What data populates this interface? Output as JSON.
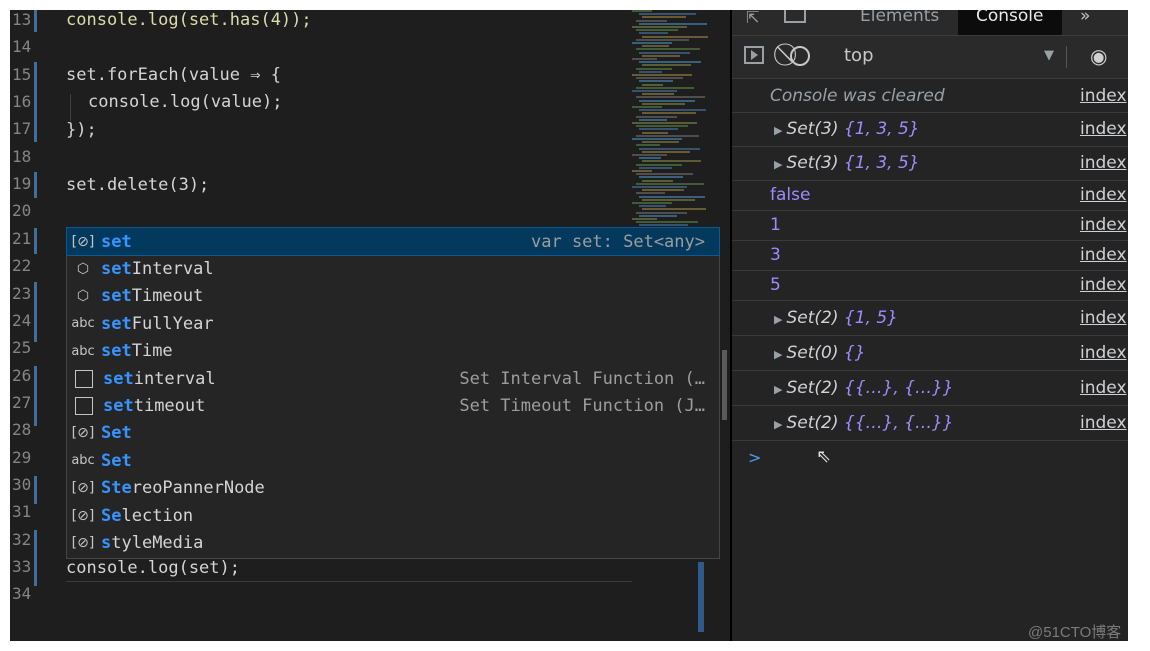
{
  "editor": {
    "lines": [
      {
        "num": "13",
        "top": 0
      },
      {
        "num": "14",
        "top": 0
      },
      {
        "num": "15",
        "top": 0
      },
      {
        "num": "16",
        "top": 0
      },
      {
        "num": "17",
        "top": 0
      },
      {
        "num": "18",
        "top": 0
      },
      {
        "num": "19",
        "top": 0
      },
      {
        "num": "20",
        "top": 0
      },
      {
        "num": "21",
        "top": 0
      },
      {
        "num": "22",
        "top": 0
      },
      {
        "num": "23",
        "top": 0
      },
      {
        "num": "24",
        "top": 0
      },
      {
        "num": "25",
        "top": 0
      },
      {
        "num": "26",
        "top": 0
      },
      {
        "num": "27",
        "top": 0
      },
      {
        "num": "28",
        "top": 0
      },
      {
        "num": "29",
        "top": 0
      },
      {
        "num": "30",
        "top": 0
      },
      {
        "num": "31",
        "top": 0
      },
      {
        "num": "32",
        "top": 0
      },
      {
        "num": "33",
        "top": 0
      },
      {
        "num": "34",
        "top": 0
      }
    ],
    "code": {
      "l13": "console.log(set.has(4));",
      "l15": "set.forEach(value ⇒ {",
      "l16": "console.log(value);",
      "l17": "});",
      "l19": "set.delete(3);",
      "l33": "console.log(set);"
    }
  },
  "suggest": {
    "items": [
      {
        "icon": "variable-icon",
        "glyph": "[⊘]",
        "match": "set",
        "rest": "",
        "detail": "var set: Set<any>",
        "selected": true
      },
      {
        "icon": "module-icon",
        "glyph": "⬡",
        "match": "set",
        "rest": "Interval",
        "detail": ""
      },
      {
        "icon": "module-icon",
        "glyph": "⬡",
        "match": "set",
        "rest": "Timeout",
        "detail": ""
      },
      {
        "icon": "text-icon",
        "glyph": "abc",
        "match": "set",
        "rest": "FullYear",
        "detail": ""
      },
      {
        "icon": "text-icon",
        "glyph": "abc",
        "match": "set",
        "rest": "Time",
        "detail": ""
      },
      {
        "icon": "snippet-icon",
        "glyph": "",
        "match": "set",
        "rest": "interval",
        "detail": "Set Interval Function (…"
      },
      {
        "icon": "snippet-icon",
        "glyph": "",
        "match": "set",
        "rest": "timeout",
        "detail": "Set Timeout Function (J…"
      },
      {
        "icon": "variable-icon",
        "glyph": "[⊘]",
        "match": "Set",
        "rest": "",
        "detail": ""
      },
      {
        "icon": "text-icon",
        "glyph": "abc",
        "match": "Set",
        "rest": "",
        "detail": ""
      },
      {
        "icon": "variable-icon",
        "glyph": "[⊘]",
        "match": "Ste",
        "rest": "reoPannerNode",
        "detail": ""
      },
      {
        "icon": "variable-icon",
        "glyph": "[⊘]",
        "match": "Se",
        "rest": "lection",
        "detail": ""
      },
      {
        "icon": "variable-icon",
        "glyph": "[⊘]",
        "match": "s",
        "rest": "tyleMedia",
        "detail": ""
      }
    ]
  },
  "devtools": {
    "tabs": {
      "elements": "Elements",
      "console": "Console",
      "more": "»"
    },
    "toolbar": {
      "context": "top"
    },
    "messages": [
      {
        "kind": "info",
        "text": "Console was cleared",
        "link": "index"
      },
      {
        "kind": "set",
        "label": "Set(3)",
        "body": "{1, 3, 5}",
        "link": "index"
      },
      {
        "kind": "set",
        "label": "Set(3)",
        "body": "{1, 3, 5}",
        "link": "index"
      },
      {
        "kind": "plain",
        "text": "false",
        "link": "index"
      },
      {
        "kind": "plain",
        "text": "1",
        "link": "index"
      },
      {
        "kind": "plain",
        "text": "3",
        "link": "index"
      },
      {
        "kind": "plain",
        "text": "5",
        "link": "index"
      },
      {
        "kind": "set",
        "label": "Set(2)",
        "body": "{1, 5}",
        "link": "index"
      },
      {
        "kind": "set",
        "label": "Set(0)",
        "body": "{}",
        "link": "index"
      },
      {
        "kind": "set",
        "label": "Set(2)",
        "body": "{{…}, {…}}",
        "link": "index"
      },
      {
        "kind": "set",
        "label": "Set(2)",
        "body": "{{…}, {…}}",
        "link": "index"
      }
    ],
    "prompt": ">"
  },
  "watermark": "@51CTO博客",
  "colors": {
    "editor_bg": "#1e1e1e",
    "highlight": "#3794ff",
    "selected_row": "#04395e",
    "console_number": "#9c8cff"
  }
}
